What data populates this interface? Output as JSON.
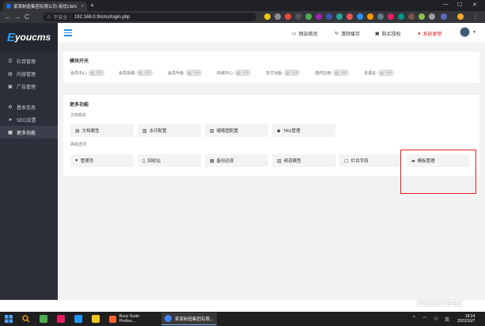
{
  "browser": {
    "tab_title": "某某制造集团有限公司-易优CMS",
    "tab_close": "×",
    "new_tab": "+",
    "back": "←",
    "forward": "→",
    "reload": "C",
    "security_label": "不安全",
    "url": "192.168.0.9/cms/login.php",
    "minimize": "—",
    "maximize": "☐",
    "close": "✕"
  },
  "sidebar": {
    "logo": "youcms",
    "logo_e": "E",
    "items": [
      {
        "label": "栏目管理",
        "icon": "list-icon"
      },
      {
        "label": "内容管理",
        "icon": "document-icon"
      },
      {
        "label": "广告管理",
        "icon": "ad-icon"
      },
      {
        "label": "基本信息",
        "icon": "gear-icon"
      },
      {
        "label": "SEO设置",
        "icon": "send-icon"
      },
      {
        "label": "更多功能",
        "icon": "grid-icon"
      }
    ]
  },
  "topnav": {
    "site_home": "网站首页",
    "clear_cache": "清除缓存",
    "buy_license": "购买授权",
    "system_update": "系统更新"
  },
  "module_switch": {
    "title": "模块开关",
    "off_label": "关闭",
    "items": [
      {
        "label": "会员中心:"
      },
      {
        "label": "会员投稿:"
      },
      {
        "label": "会员升级:"
      },
      {
        "label": "商城中心:"
      },
      {
        "label": "支付功能:"
      },
      {
        "label": "插件应用:"
      },
      {
        "label": "多语言:"
      }
    ]
  },
  "more": {
    "title": "更多功能",
    "doc_section": "文档相关",
    "doc_items": [
      {
        "label": "文档属性",
        "icon": "document-icon"
      },
      {
        "label": "水印配置",
        "icon": "image-icon"
      },
      {
        "label": "缩略图配置",
        "icon": "thumbnail-icon"
      },
      {
        "label": "TAG管理",
        "icon": "tag-icon"
      }
    ],
    "adv_section": "高级选项",
    "adv_items": [
      {
        "label": "管理员",
        "icon": "user-icon"
      },
      {
        "label": "回收站",
        "icon": "trash-icon"
      },
      {
        "label": "备份还原",
        "icon": "database-icon"
      },
      {
        "label": "频道模型",
        "icon": "model-icon"
      },
      {
        "label": "栏目字段",
        "icon": "field-icon"
      },
      {
        "label": "模板管理",
        "icon": "folder-icon"
      }
    ]
  },
  "taskbar": {
    "apps": [
      {
        "label": "Burp Suite Profes..."
      },
      {
        "label": "某某制造集团有限..."
      }
    ],
    "ime": "英",
    "time": "18:24",
    "date": "2022/10/7"
  },
  "watermark": "moonsec",
  "colors": {
    "accent": "#2b8de0",
    "sidebar_bg": "#2c2f3a",
    "highlight": "#e0201f",
    "update_red": "#d9251d"
  }
}
